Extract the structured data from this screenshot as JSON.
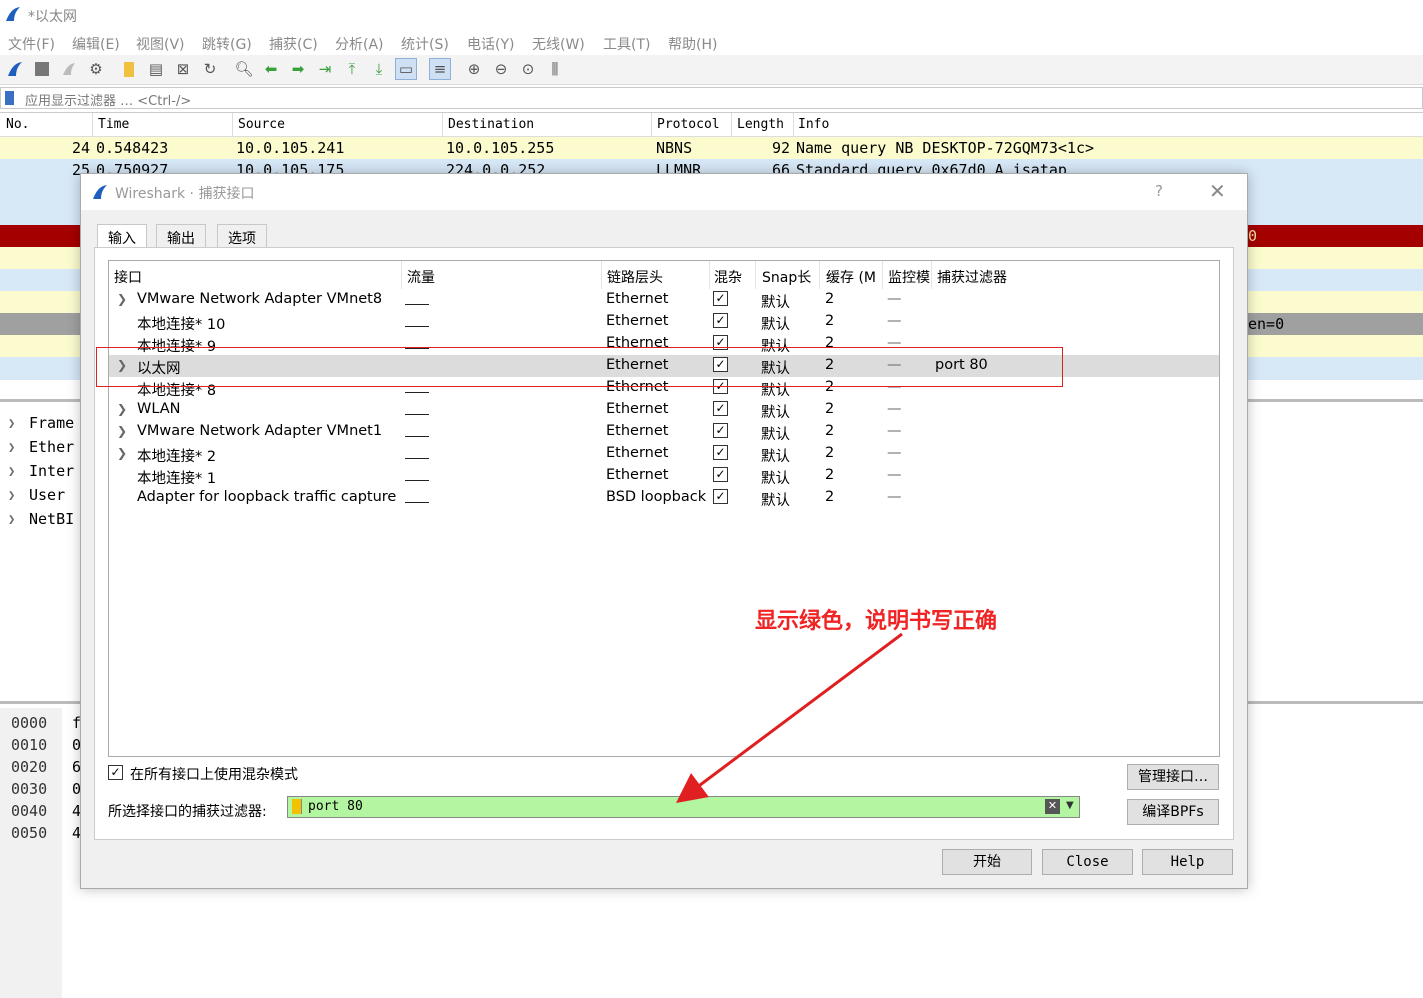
{
  "window": {
    "title": "*以太网"
  },
  "menu": [
    "文件(F)",
    "编辑(E)",
    "视图(V)",
    "跳转(G)",
    "捕获(C)",
    "分析(A)",
    "统计(S)",
    "电话(Y)",
    "无线(W)",
    "工具(T)",
    "帮助(H)"
  ],
  "filter": {
    "placeholder": "应用显示过滤器 … <Ctrl-/>"
  },
  "packet_list": {
    "headers": [
      "No.",
      "Time",
      "Source",
      "Destination",
      "Protocol",
      "Length",
      "Info"
    ],
    "rows": [
      {
        "no": "24",
        "time": "0.548423",
        "source": "10.0.105.241",
        "destination": "10.0.105.255",
        "protocol": "NBNS",
        "length": "92",
        "info": "Name query NB DESKTOP-72GQM73<1c>",
        "color": "#fbfbce"
      },
      {
        "no": "25",
        "time": "0.750927",
        "source": "10.0.105.175",
        "destination": "224.0.0.252",
        "protocol": "LLMNR",
        "length": "66",
        "info": "Standard query 0x67d0 A isatap",
        "color": "#d7e8f7"
      },
      {
        "no": "2",
        "time": "",
        "source": "",
        "destination": "",
        "protocol": "",
        "length": "",
        "info": "",
        "color": "#d7e8f7"
      },
      {
        "no": "2",
        "time": "",
        "source": "",
        "destination": "",
        "protocol": "",
        "length": "",
        "info": "",
        "color": "#d7e8f7"
      },
      {
        "no": "2",
        "time": "",
        "source": "",
        "destination": "",
        "protocol": "",
        "length": "",
        "info": "0",
        "color": "#a40000"
      },
      {
        "no": "2",
        "time": "",
        "source": "",
        "destination": "",
        "protocol": "",
        "length": "",
        "info": "",
        "color": "#fbfbce"
      },
      {
        "no": "3",
        "time": "",
        "source": "",
        "destination": "",
        "protocol": "",
        "length": "",
        "info": "",
        "color": "#d7e8f7"
      },
      {
        "no": "3",
        "time": "",
        "source": "",
        "destination": "",
        "protocol": "",
        "length": "",
        "info": "",
        "color": "#fbfbce"
      },
      {
        "no": "3",
        "time": "",
        "source": "",
        "destination": "",
        "protocol": "",
        "length": "",
        "info": "en=0",
        "color": "#a0a0a0"
      },
      {
        "no": "3",
        "time": "",
        "source": "",
        "destination": "",
        "protocol": "",
        "length": "",
        "info": "",
        "color": "#fbfbce"
      },
      {
        "no": "3",
        "time": "",
        "source": "",
        "destination": "",
        "protocol": "",
        "length": "",
        "info": "",
        "color": "#d7e8f7"
      }
    ]
  },
  "details": [
    "Frame",
    "Ether",
    "Inter",
    "User",
    "NetBI"
  ],
  "bytes": {
    "offsets": [
      "0000",
      "0010",
      "0020",
      "0030",
      "0040",
      "0050"
    ],
    "first_chars": [
      "f",
      "0",
      "6",
      "0",
      "4",
      "4"
    ]
  },
  "dialog": {
    "title": "Wireshark · 捕获接口",
    "help_glyph": "?",
    "tabs": [
      "输入",
      "输出",
      "选项"
    ],
    "columns": [
      "接口",
      "流量",
      "链路层头",
      "混杂",
      "Snap长",
      "缓存 (M",
      "监控模",
      "捕获过滤器"
    ],
    "interfaces": [
      {
        "name": "VMware Network Adapter VMnet8",
        "expandable": true,
        "link": "Ethernet",
        "promisc": true,
        "snap": "默认",
        "buffer": "2",
        "monitor": "—",
        "filter": ""
      },
      {
        "name": "本地连接* 10",
        "expandable": false,
        "link": "Ethernet",
        "promisc": true,
        "snap": "默认",
        "buffer": "2",
        "monitor": "—",
        "filter": ""
      },
      {
        "name": "本地连接* 9",
        "expandable": false,
        "link": "Ethernet",
        "promisc": true,
        "snap": "默认",
        "buffer": "2",
        "monitor": "—",
        "filter": ""
      },
      {
        "name": "以太网",
        "expandable": true,
        "link": "Ethernet",
        "promisc": true,
        "snap": "默认",
        "buffer": "2",
        "monitor": "—",
        "filter": "port 80",
        "selected": true
      },
      {
        "name": "本地连接* 8",
        "expandable": false,
        "link": "Ethernet",
        "promisc": true,
        "snap": "默认",
        "buffer": "2",
        "monitor": "—",
        "filter": ""
      },
      {
        "name": "WLAN",
        "expandable": true,
        "link": "Ethernet",
        "promisc": true,
        "snap": "默认",
        "buffer": "2",
        "monitor": "—",
        "filter": ""
      },
      {
        "name": "VMware Network Adapter VMnet1",
        "expandable": true,
        "link": "Ethernet",
        "promisc": true,
        "snap": "默认",
        "buffer": "2",
        "monitor": "—",
        "filter": ""
      },
      {
        "name": "本地连接* 2",
        "expandable": true,
        "link": "Ethernet",
        "promisc": true,
        "snap": "默认",
        "buffer": "2",
        "monitor": "—",
        "filter": ""
      },
      {
        "name": "本地连接* 1",
        "expandable": false,
        "link": "Ethernet",
        "promisc": true,
        "snap": "默认",
        "buffer": "2",
        "monitor": "—",
        "filter": ""
      },
      {
        "name": "Adapter for loopback traffic capture",
        "expandable": false,
        "link": "BSD loopback",
        "promisc": true,
        "snap": "默认",
        "buffer": "2",
        "monitor": "—",
        "filter": ""
      }
    ],
    "promisc_all_label": "在所有接口上使用混杂模式",
    "promisc_all_checked": true,
    "capture_filter_label": "所选择接口的捕获过滤器:",
    "capture_filter_value": "port 80",
    "capture_filter_color": "#b3f5a1",
    "manage_button": "管理接口…",
    "compile_button": "编译BPFs",
    "start_button": "开始",
    "close_button": "Close",
    "help_button": "Help"
  },
  "annotation": {
    "text": "显示绿色，说明书写正确",
    "color": "#f02424"
  }
}
